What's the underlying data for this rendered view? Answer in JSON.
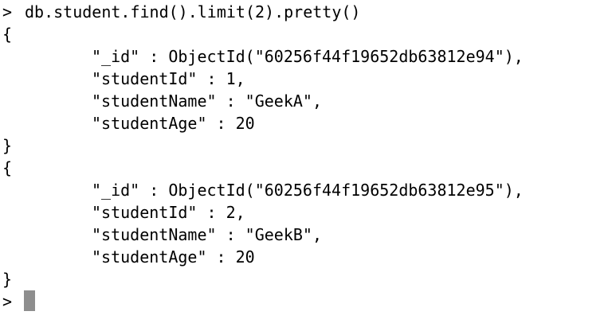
{
  "terminal": {
    "prompt": ">",
    "command": "db.student.find().limit(2).pretty()",
    "documents": [
      {
        "open": "{",
        "fields": [
          "\"_id\" : ObjectId(\"60256f44f19652db63812e94\"),",
          "\"studentId\" : 1,",
          "\"studentName\" : \"GeekA\",",
          "\"studentAge\" : 20"
        ],
        "close": "}"
      },
      {
        "open": "{",
        "fields": [
          "\"_id\" : ObjectId(\"60256f44f19652db63812e95\"),",
          "\"studentId\" : 2,",
          "\"studentName\" : \"GeekB\",",
          "\"studentAge\" : 20"
        ],
        "close": "}"
      }
    ],
    "final_prompt": ">",
    "colors": {
      "background": "#ffffff",
      "text": "#000000",
      "cursor": "#8e8e8e"
    }
  }
}
